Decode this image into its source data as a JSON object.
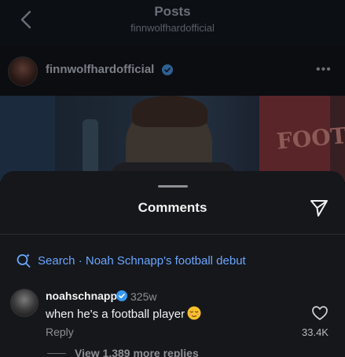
{
  "header": {
    "title": "Posts",
    "subtitle": "finnwolfhardofficial"
  },
  "post": {
    "username": "finnwolfhardofficial",
    "verified": true,
    "image_text": "FOOT",
    "more_icon": "more-horizontal-icon"
  },
  "comments_sheet": {
    "title": "Comments",
    "share_icon": "send-icon",
    "search_label": "Search · Noah Schnapp's football debut",
    "search_icon": "sparkle-search-icon",
    "accent_color": "#6aa6ff"
  },
  "comment": {
    "username": "noahschnapp",
    "verified": true,
    "age": "325w",
    "text": "when he's a football player",
    "emoji": "relieved-face-emoji",
    "reply_label": "Reply",
    "likes": "33.4K",
    "like_icon": "heart-icon",
    "view_replies": "View 1,389 more replies"
  },
  "colors": {
    "background": "#000000",
    "sheet": "#15171b",
    "verified_badge": "#3897f0"
  }
}
